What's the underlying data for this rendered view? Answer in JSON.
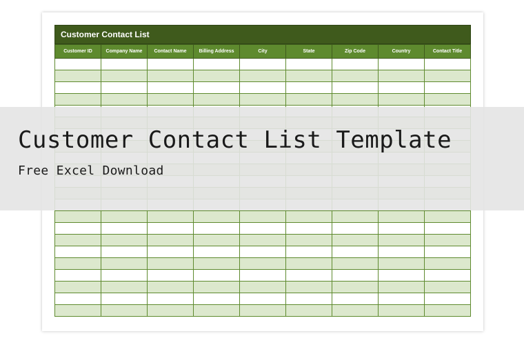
{
  "sheet": {
    "title": "Customer Contact List",
    "columns": [
      "Customer ID",
      "Company Name",
      "Contact Name",
      "Billing Address",
      "City",
      "State",
      "Zip Code",
      "Country",
      "Contact Title"
    ],
    "row_count": 22
  },
  "overlay": {
    "title": "Customer Contact List Template",
    "subtitle": "Free Excel Download"
  }
}
